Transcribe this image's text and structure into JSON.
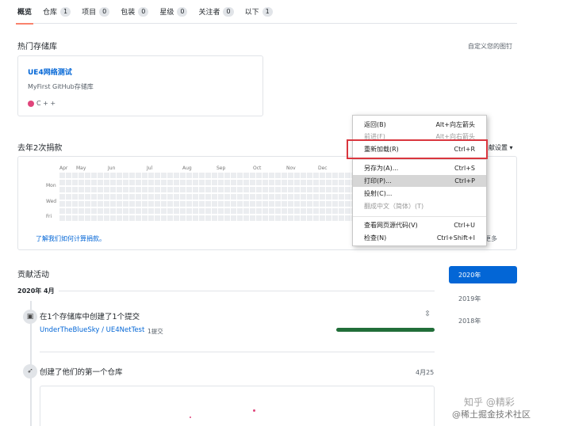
{
  "tabs": [
    {
      "label": "概览",
      "count": ""
    },
    {
      "label": "仓库",
      "count": "1"
    },
    {
      "label": "项目",
      "count": "0"
    },
    {
      "label": "包装",
      "count": "0"
    },
    {
      "label": "星级",
      "count": "0"
    },
    {
      "label": "关注者",
      "count": "0"
    },
    {
      "label": "以下",
      "count": "1"
    }
  ],
  "pinned": {
    "title": "热门存储库",
    "customize": "自定义您的图钉",
    "repo_name": "UE4网络测试",
    "repo_desc": "MyFirst GitHub存储库",
    "language": "C + +",
    "lang_color": "#e0457b"
  },
  "graph": {
    "title": "去年2次捐款",
    "settings": "献设置 ▾",
    "months": [
      "Apr",
      "May",
      "Jun",
      "Jul",
      "Aug",
      "Sep",
      "Oct",
      "Nov",
      "Dec"
    ],
    "days": [
      "Mon",
      "Wed",
      "Fri"
    ],
    "learn_link": "了解我们如何计算捐款。",
    "more": "更多"
  },
  "activity": {
    "title": "贡献活动",
    "month_heading": "2020年 4月",
    "years": [
      "2020年",
      "2019年",
      "2018年"
    ],
    "event1_title": "在1个存储库中创建了1个提交",
    "event1_repo": "UnderTheBlueSky / UE4NetTest",
    "event1_count": "1提交",
    "event2_title": "创建了他们的第一个仓库",
    "event2_date": "4月25"
  },
  "context_menu": {
    "items": [
      {
        "label": "返回(B)",
        "shortcut": "Alt+向左箭头",
        "disabled": false
      },
      {
        "label": "前进(F)",
        "shortcut": "Alt+向右箭头",
        "disabled": true
      },
      {
        "label": "重新加载(R)",
        "shortcut": "Ctrl+R",
        "disabled": false
      },
      {
        "label": "另存为(A)...",
        "shortcut": "Ctrl+S",
        "disabled": false
      },
      {
        "label": "打印(P)...",
        "shortcut": "Ctrl+P",
        "disabled": false
      },
      {
        "label": "投射(C)...",
        "shortcut": "",
        "disabled": false
      },
      {
        "label": "翻成中文（简体）(T)",
        "shortcut": "",
        "disabled": true
      },
      {
        "label": "查看网页源代码(V)",
        "shortcut": "Ctrl+U",
        "disabled": false
      },
      {
        "label": "检查(N)",
        "shortcut": "Ctrl+Shift+I",
        "disabled": false
      }
    ]
  },
  "watermark": {
    "line1": "知乎 @精彩",
    "line2": "@稀土掘金技术社区"
  }
}
